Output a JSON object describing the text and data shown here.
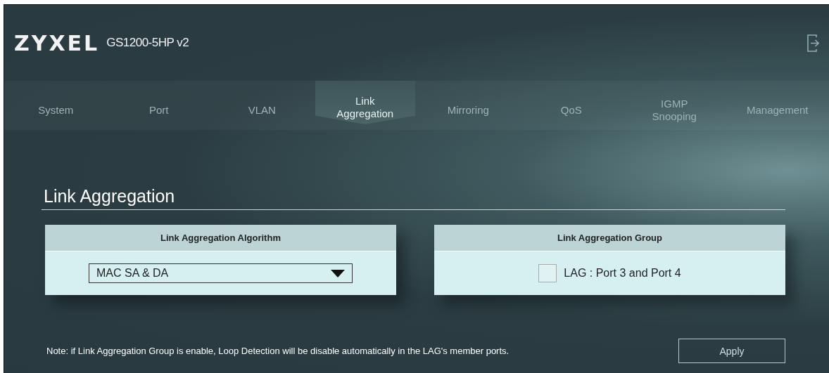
{
  "header": {
    "logo": "ZYXEL",
    "model": "GS1200-5HP v2"
  },
  "tabs": [
    {
      "label": "System",
      "selected": false
    },
    {
      "label": "Port",
      "selected": false
    },
    {
      "label": "VLAN",
      "selected": false
    },
    {
      "label": "Link\nAggregation",
      "selected": true
    },
    {
      "label": "Mirroring",
      "selected": false
    },
    {
      "label": "QoS",
      "selected": false
    },
    {
      "label": "IGMP\nSnooping",
      "selected": false
    },
    {
      "label": "Management",
      "selected": false
    }
  ],
  "section_title": "Link Aggregation",
  "algorithm_panel": {
    "heading": "Link Aggregation Algorithm",
    "value": "MAC SA & DA"
  },
  "group_panel": {
    "heading": "Link Aggregation Group",
    "checkbox": {
      "label": "LAG : Port 3 and Port 4",
      "checked": false
    }
  },
  "note": "Note: if Link Aggregation Group is enable, Loop Detection will be disable automatically in the LAG's member ports.",
  "apply_button": "Apply"
}
